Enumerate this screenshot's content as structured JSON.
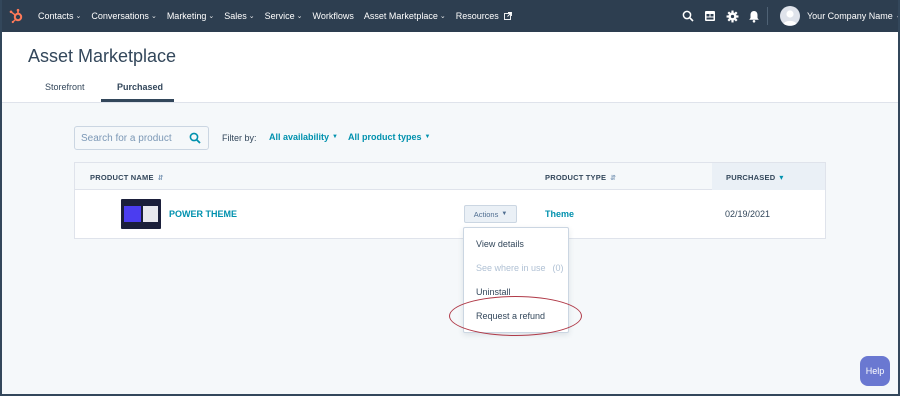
{
  "nav": {
    "items": [
      {
        "label": "Contacts",
        "dropdown": true
      },
      {
        "label": "Conversations",
        "dropdown": true
      },
      {
        "label": "Marketing",
        "dropdown": true
      },
      {
        "label": "Sales",
        "dropdown": true
      },
      {
        "label": "Service",
        "dropdown": true
      },
      {
        "label": "Workflows",
        "dropdown": false
      },
      {
        "label": "Asset Marketplace",
        "dropdown": true
      },
      {
        "label": "Resources",
        "dropdown": false,
        "external": true
      }
    ],
    "icons": [
      "search-icon",
      "marketplace-icon",
      "settings-icon",
      "notifications-icon"
    ],
    "account_label": "Your Company Name"
  },
  "header": {
    "title": "Asset Marketplace",
    "tabs": [
      {
        "label": "Storefront",
        "active": false
      },
      {
        "label": "Purchased",
        "active": true
      }
    ]
  },
  "filters": {
    "search_placeholder": "Search for a product",
    "filter_label": "Filter by:",
    "availability": "All availability",
    "product_types": "All product types"
  },
  "table": {
    "columns": [
      "PRODUCT NAME",
      "PRODUCT TYPE",
      "PURCHASED"
    ],
    "rows": [
      {
        "name": "POWER THEME",
        "actions_label": "Actions",
        "type": "Theme",
        "purchased": "02/19/2021"
      }
    ]
  },
  "actions_menu": {
    "items": [
      {
        "label": "View details",
        "disabled": false
      },
      {
        "label": "See where in use",
        "count": "(0)",
        "disabled": true
      },
      {
        "label": "Uninstall",
        "disabled": false
      },
      {
        "label": "Request a refund",
        "disabled": false,
        "highlighted": true
      }
    ]
  },
  "help_label": "Help",
  "colors": {
    "nav_bg": "#2d3e50",
    "link": "#0091ae",
    "text": "#33475b",
    "highlight_circle": "#b03a48",
    "help_bg": "#6a78d1"
  }
}
